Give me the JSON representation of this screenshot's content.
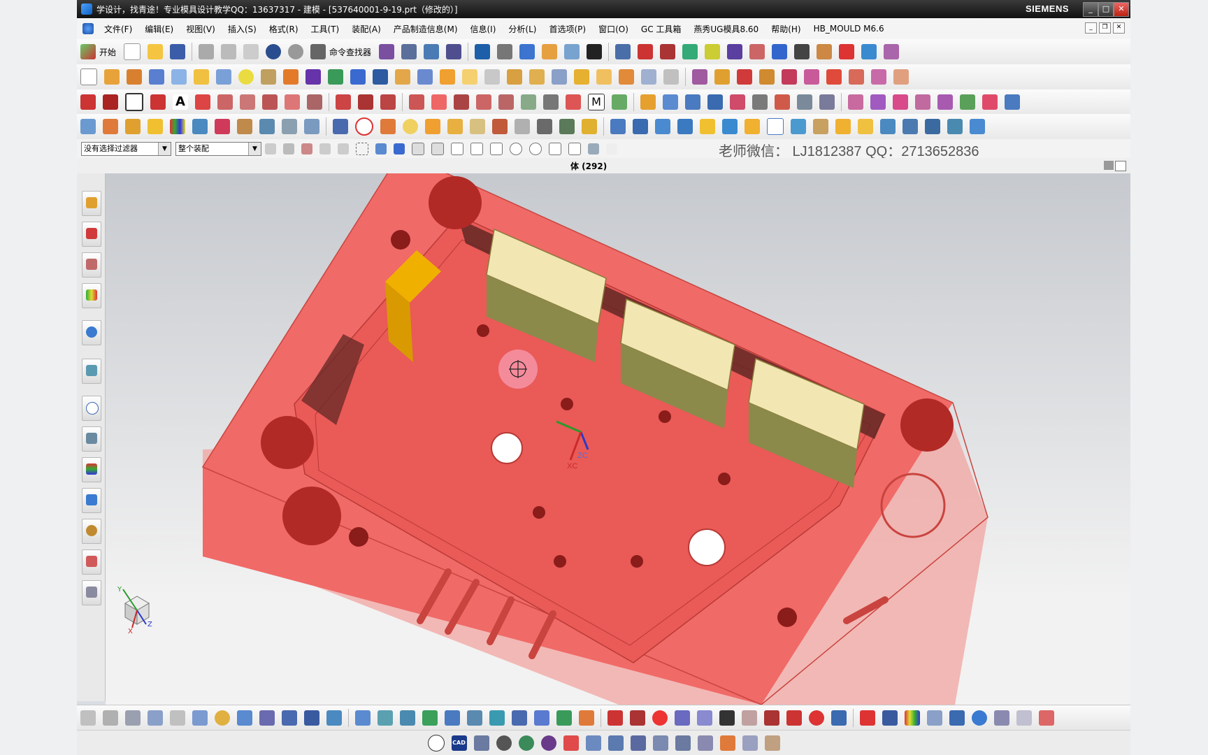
{
  "window": {
    "title": "学设计，找青途！专业模具设计教学QQ：13637317 - 建模 - [537640001-9-19.prt（修改的）]",
    "brand": "SIEMENS"
  },
  "menu": {
    "items": [
      "文件(F)",
      "编辑(E)",
      "视图(V)",
      "插入(S)",
      "格式(R)",
      "工具(T)",
      "装配(A)",
      "产品制造信息(M)",
      "信息(I)",
      "分析(L)",
      "首选项(P)",
      "窗口(O)",
      "GC 工具箱",
      "燕秀UG模具8.60",
      "帮助(H)",
      "HB_MOULD M6.6"
    ]
  },
  "toolbar": {
    "start_label": "开始",
    "command_finder_label": "命令查找器"
  },
  "filter": {
    "type_filter": "没有选择过滤器",
    "scope_filter": "整个装配"
  },
  "contact": "老师微信：  LJ1812387   QQ：2713652836",
  "status": {
    "selection_info": "体 (292)"
  },
  "axes": {
    "zc": "ZC",
    "xc": "XC",
    "y": "Y",
    "z": "Z",
    "x": "X"
  },
  "bottom": {
    "cad_label": "CAD"
  },
  "colors": {
    "mold_plate": "#f06a67",
    "insert_gold": "#f2e6b3",
    "highlight_orange": "#f0b000",
    "viewport_top": "#c6c9ce",
    "viewport_bottom": "#f2f2f2"
  }
}
